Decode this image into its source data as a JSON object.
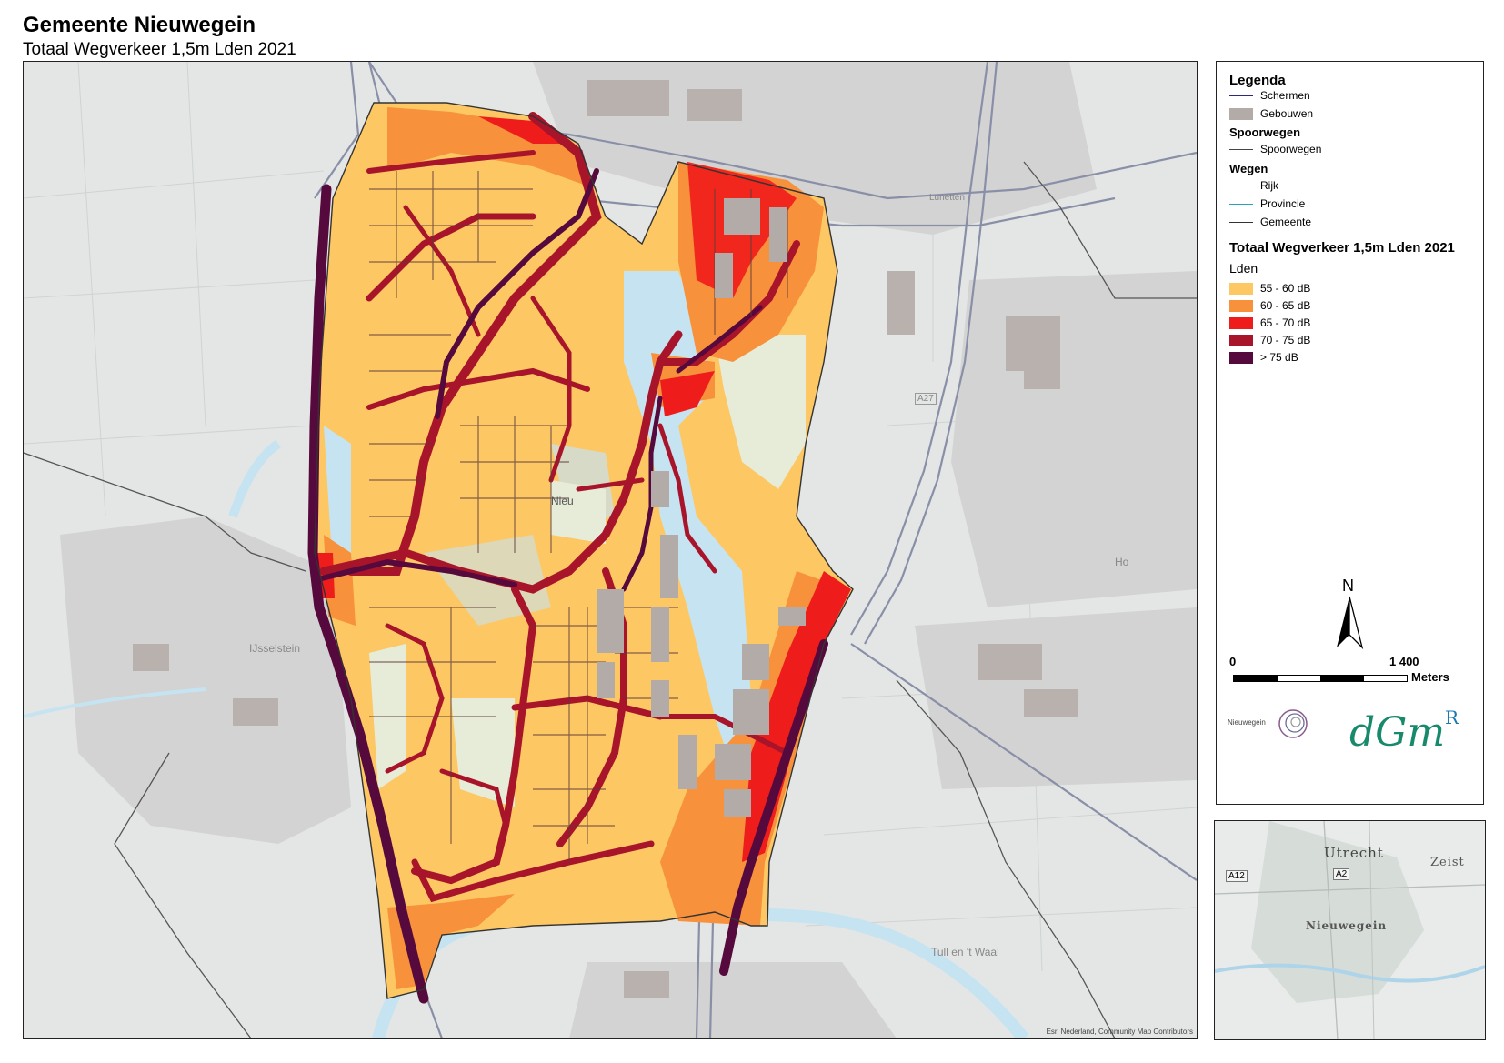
{
  "header": {
    "title": "Gemeente Nieuwegein",
    "subtitle": "Totaal Wegverkeer 1,5m Lden 2021"
  },
  "map": {
    "place_labels": {
      "nieuwegein": "Nieu",
      "ijsselstein": "IJsselstein",
      "lunetten": "Lunetten",
      "tull": "Tull en 't Waal",
      "houten": "Ho",
      "road_a27": "A27"
    },
    "credit": "Esri Nederland, Community Map Contributors",
    "colors": {
      "c55_60": "#fdc763",
      "c60_65": "#f7913b",
      "c65_70": "#ef1c1c",
      "c70_75": "#a8142a",
      "c75plus": "#56093c",
      "water": "#c6e3f2",
      "basemap": "#e3e6e4",
      "buildings": "#b3aba7"
    }
  },
  "legend": {
    "title": "Legenda",
    "schermen": "Schermen",
    "gebouwen": "Gebouwen",
    "spoorwegen_head": "Spoorwegen",
    "spoorwegen": "Spoorwegen",
    "wegen_head": "Wegen",
    "rijk": "Rijk",
    "provincie": "Provincie",
    "gemeente": "Gemeente",
    "layer_title": "Totaal Wegverkeer 1,5m Lden 2021",
    "layer_sub": "Lden",
    "classes": [
      "55 - 60 dB",
      "60 - 65 dB",
      "65 - 70 dB",
      "70 - 75 dB",
      "> 75 dB"
    ],
    "class_colors": [
      "#fdc763",
      "#f7913b",
      "#ef1c1c",
      "#a8142a",
      "#56093c"
    ],
    "north": "N",
    "scale_start": "0",
    "scale_end": "1 400",
    "scale_unit": "Meters"
  },
  "logos": {
    "nieuwegein": "Nieuwegein",
    "dgmr_main": "dGm",
    "dgmr_sup": "R"
  },
  "inset": {
    "labels": [
      "Utrecht",
      "Zeist",
      "A12",
      "A2",
      "Nieuwegein"
    ]
  }
}
